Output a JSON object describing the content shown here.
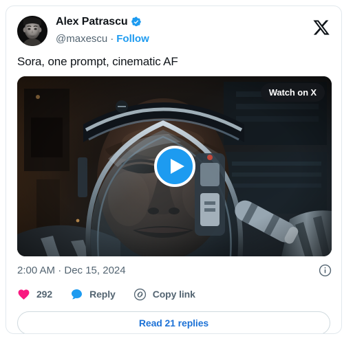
{
  "card": {
    "border_color": "#e1e8ed",
    "background": "#ffffff"
  },
  "author": {
    "display_name": "Alex Patrascu",
    "handle": "@maxescu",
    "separator": "·",
    "follow_label": "Follow",
    "verified": true,
    "verified_color": "#1d9bf0",
    "avatar_alt": "avatar"
  },
  "brand": {
    "logo_name": "x-logo"
  },
  "tweet": {
    "text": "Sora, one prompt, cinematic AF"
  },
  "media": {
    "type": "video",
    "watch_badge_label": "Watch on X",
    "play_button_color": "#1d9bf0",
    "alt": "Astronaut in a space helmet, cinematic close-up"
  },
  "meta": {
    "timestamp": "2:00 AM · Dec 15, 2024",
    "info_icon_name": "info-circle-icon"
  },
  "actions": [
    {
      "id": "like",
      "icon": "heart-icon",
      "label": "292",
      "color": "#f91880"
    },
    {
      "id": "reply",
      "icon": "reply-icon",
      "label": "Reply",
      "color": "#1d9bf0"
    },
    {
      "id": "copylink",
      "icon": "link-icon",
      "label": "Copy link",
      "color": "#536471"
    }
  ],
  "reply_button": {
    "label": "Read 21 replies",
    "color": "#1d72d6"
  }
}
